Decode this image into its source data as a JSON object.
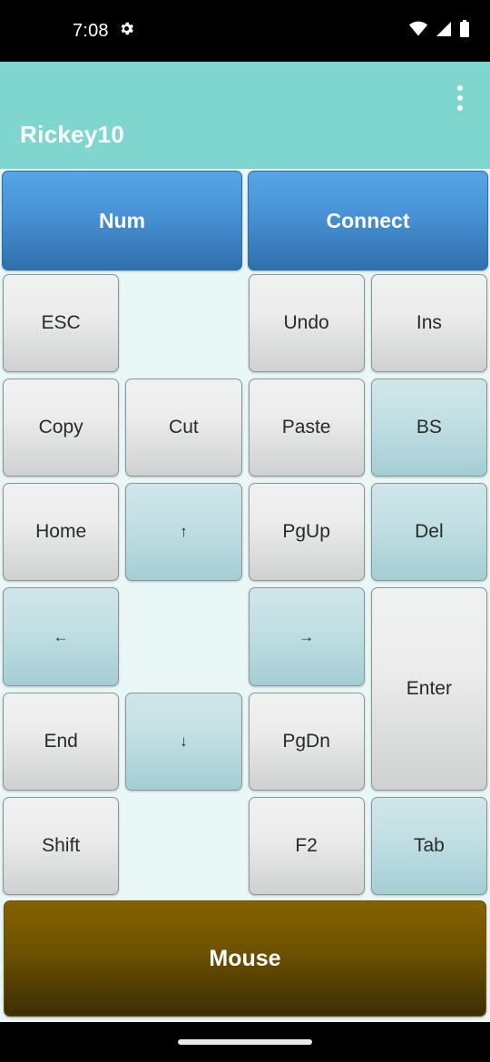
{
  "status_bar": {
    "time": "7:08",
    "icons": [
      "settings-gear-icon",
      "wifi-icon",
      "cellular-signal-icon",
      "battery-icon"
    ]
  },
  "app_bar": {
    "title": "Rickey10",
    "overflow_label": "more-options",
    "background_color": "#7ed6ce"
  },
  "top_buttons": [
    {
      "label": "Num"
    },
    {
      "label": "Connect"
    }
  ],
  "keypad": {
    "columns": 4,
    "rows": 6,
    "keys": [
      {
        "label": "ESC",
        "style": "gray",
        "name": "key-esc"
      },
      {
        "label": "",
        "style": "empty",
        "name": "key-empty-r1c2"
      },
      {
        "label": "Undo",
        "style": "gray",
        "name": "key-undo"
      },
      {
        "label": "Ins",
        "style": "gray",
        "name": "key-ins"
      },
      {
        "label": "Copy",
        "style": "gray",
        "name": "key-copy"
      },
      {
        "label": "Cut",
        "style": "gray",
        "name": "key-cut"
      },
      {
        "label": "Paste",
        "style": "gray",
        "name": "key-paste"
      },
      {
        "label": "BS",
        "style": "teal",
        "name": "key-backspace"
      },
      {
        "label": "Home",
        "style": "gray",
        "name": "key-home"
      },
      {
        "label": "↑",
        "style": "teal",
        "name": "key-arrow-up",
        "arrow": true
      },
      {
        "label": "PgUp",
        "style": "gray",
        "name": "key-pgup"
      },
      {
        "label": "Del",
        "style": "teal",
        "name": "key-delete"
      },
      {
        "label": "←",
        "style": "teal",
        "name": "key-arrow-left",
        "arrow": true
      },
      {
        "label": "",
        "style": "empty",
        "name": "key-empty-r4c2"
      },
      {
        "label": "→",
        "style": "teal",
        "name": "key-arrow-right",
        "arrow": true
      },
      {
        "label": "Enter",
        "style": "gray",
        "name": "key-enter",
        "tall": true
      },
      {
        "label": "End",
        "style": "gray",
        "name": "key-end"
      },
      {
        "label": "↓",
        "style": "teal",
        "name": "key-arrow-down",
        "arrow": true
      },
      {
        "label": "PgDn",
        "style": "gray",
        "name": "key-pgdn"
      },
      {
        "label": "Shift",
        "style": "gray",
        "name": "key-shift"
      },
      {
        "label": "",
        "style": "empty",
        "name": "key-empty-r6c2"
      },
      {
        "label": "F2",
        "style": "gray",
        "name": "key-f2"
      },
      {
        "label": "Tab",
        "style": "teal",
        "name": "key-tab"
      }
    ]
  },
  "mouse_button": {
    "label": "Mouse"
  },
  "nav_bar": {
    "gesture_pill": "home-gesture-pill"
  }
}
